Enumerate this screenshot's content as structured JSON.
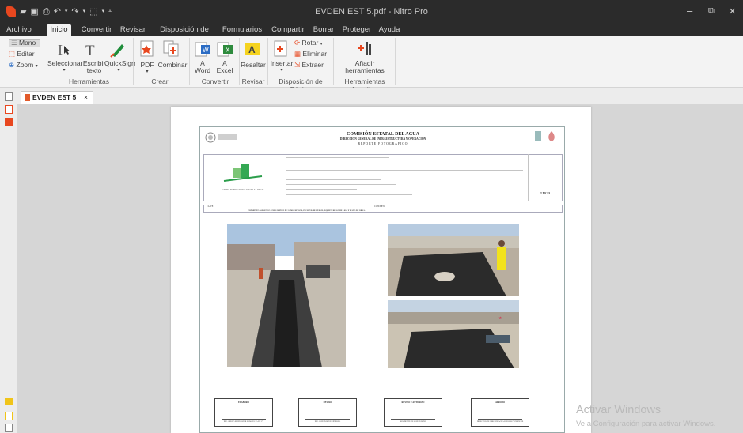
{
  "titlebar": {
    "title": "EVDEN EST 5.pdf - Nitro Pro",
    "minimize_glyph": "–",
    "maximize_glyph": "⧉",
    "close_glyph": "✕"
  },
  "menu": {
    "tabs": [
      "Archivo",
      "Inicio",
      "Convertir",
      "Revisar",
      "Disposición de Página",
      "Formularios",
      "Compartir",
      "Borrar",
      "Proteger",
      "Ayuda"
    ],
    "active": "Inicio"
  },
  "ribbon": {
    "herramientas": {
      "mano": "Mano",
      "editar": "Editar",
      "zoom": "Zoom",
      "seleccionar": "Seleccionar",
      "escribir_1": "Escribir",
      "escribir_2": "texto",
      "quicksign": "QuickSign",
      "group": "Herramientas"
    },
    "crear": {
      "pdf": "PDF",
      "combinar": "Combinar",
      "group": "Crear"
    },
    "convertir": {
      "a_word_1": "A",
      "a_word_2": "Word",
      "a_excel_1": "A",
      "a_excel_2": "Excel",
      "group": "Convertir"
    },
    "revisar": {
      "resaltar": "Resaltar",
      "group": "Revisar"
    },
    "disposicion": {
      "insertar": "Insertar",
      "rotar": "Rotar",
      "eliminar": "Eliminar",
      "extraer": "Extraer",
      "group": "Disposición de Página"
    },
    "favoritas": {
      "anadir_1": "Añadir",
      "anadir_2": "herramientas",
      "group": "Herramientas favoritas"
    }
  },
  "document_tab": {
    "label": "EVDEN EST 5",
    "close": "×"
  },
  "document": {
    "org_title": "COMISIÓN ESTATAL DEL AGUA",
    "org_subtitle": "DIRECCIÓN GENERAL DE INFRAESTRUCTURA Y OPERACIÓN",
    "report_title": "REPORTE FOTOGRAFICO",
    "contractor": "GRUPO EDIFICADOR BAMAYA SA DE CV",
    "page_number": "2 DE 93",
    "clave_label": "CLAVE",
    "concepto_label": "CONCEPTO",
    "concept_text": "PAVIMENTO ASFALTICO CON CARPETA DE 5 CMS ESPESOR, INCLUYE: MATERIAL, EQUIPO, RIEGO DE LIGA Y MANO DE OBRA.",
    "signatures": [
      {
        "title": "ELABORÓ",
        "name": "ING. GRUPO EDIFICADOR BAMAYA SA DE CV"
      },
      {
        "title": "REVISÓ",
        "name": "ING. SUPERVISIÓN EXTERNA"
      },
      {
        "title": "REVISÓ Y AUTORIZÓ",
        "name": "RESIDENTE DE SUPERVISIÓN"
      },
      {
        "title": "APROBÓ",
        "name": "DIRECTOR DE OBRA DE AGUA POTABLE Y DRENAJE"
      }
    ]
  },
  "windows_watermark": {
    "line1": "Activar Windows",
    "line2": "Ve a Configuración para activar Windows."
  },
  "colors": {
    "titlebar_bg": "#2b2b2b",
    "ribbon_bg": "#f3f3f3",
    "accent_orange": "#e8471f",
    "word_blue": "#2b6cc4",
    "excel_green": "#2e8b3e",
    "highlight_yellow": "#f5d31f"
  }
}
